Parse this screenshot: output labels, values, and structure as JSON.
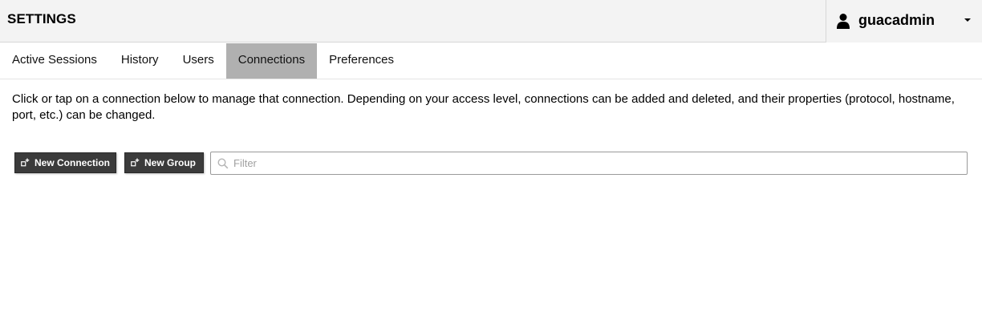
{
  "header": {
    "title": "SETTINGS",
    "user": {
      "name": "guacadmin",
      "icon": "user-icon"
    }
  },
  "tabs": [
    {
      "label": "Active Sessions",
      "active": false
    },
    {
      "label": "History",
      "active": false
    },
    {
      "label": "Users",
      "active": false
    },
    {
      "label": "Connections",
      "active": true
    },
    {
      "label": "Preferences",
      "active": false
    }
  ],
  "description": "Click or tap on a connection below to manage that connection. Depending on your access level, connections can be added and deleted, and their properties (protocol, hostname, port, etc.) can be changed.",
  "toolbar": {
    "new_connection_label": "New Connection",
    "new_group_label": "New Group"
  },
  "filter": {
    "placeholder": "Filter",
    "value": ""
  },
  "colors": {
    "header_bg": "#f3f3f3",
    "active_tab_bg": "#b0b0b0",
    "button_bg": "#3b3b3b",
    "button_text": "#ffffff"
  }
}
